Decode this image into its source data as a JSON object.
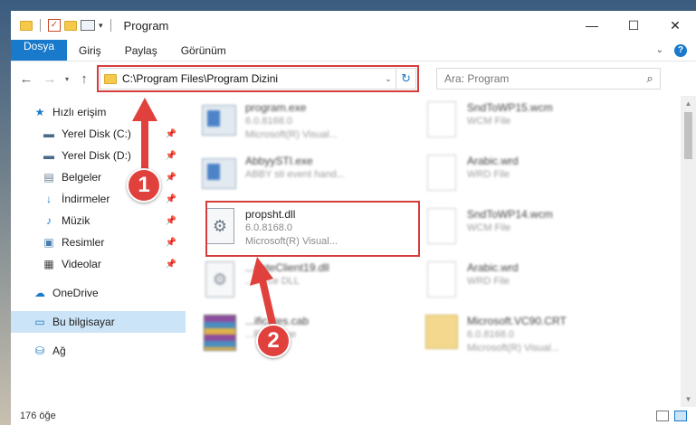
{
  "window": {
    "title": "Program",
    "controls": {
      "minimize": "—",
      "maximize": "☐",
      "close": "✕"
    }
  },
  "ribbon": {
    "tabs": [
      "Dosya",
      "Giriş",
      "Paylaş",
      "Görünüm"
    ],
    "help_label": "?"
  },
  "address": {
    "path": "C:\\Program Files\\Program Dizini"
  },
  "search": {
    "placeholder": "Ara: Program"
  },
  "sidebar": {
    "quick_access": "Hızlı erişim",
    "items": [
      {
        "label": "Yerel Disk (C:)",
        "icon": "drive-icon"
      },
      {
        "label": "Yerel Disk (D:)",
        "icon": "drive-icon"
      },
      {
        "label": "Belgeler",
        "icon": "documents-icon"
      },
      {
        "label": "İndirmeler",
        "icon": "download-icon"
      },
      {
        "label": "Müzik",
        "icon": "music-icon"
      },
      {
        "label": "Resimler",
        "icon": "pictures-icon"
      },
      {
        "label": "Videolar",
        "icon": "videos-icon"
      }
    ],
    "onedrive": "OneDrive",
    "this_pc": "Bu bilgisayar",
    "network": "Ağ"
  },
  "files": [
    {
      "name": "program.exe",
      "line2": "6.0.8168.0",
      "line3": "Microsoft(R) Visual...",
      "icon": "setup-exe-icon",
      "blur": true
    },
    {
      "name": "SndToWP15.wcm",
      "line2": "WCM File",
      "line3": "",
      "icon": "document-icon",
      "blur": true
    },
    {
      "name": "AbbyySTI.exe",
      "line2": "ABBY sti event hand...",
      "line3": "",
      "icon": "exe-icon",
      "blur": true
    },
    {
      "name": "Arabic.wrd",
      "line2": "WRD File",
      "line3": "",
      "icon": "document-icon",
      "blur": true
    },
    {
      "name": "propsht.dll",
      "line2": "6.0.8168.0",
      "line3": "Microsoft(R) Visual...",
      "icon": "dll-gear-icon",
      "blur": false
    },
    {
      "name": "SndToWP14.wcm",
      "line2": "WCM File",
      "line3": "",
      "icon": "document-icon",
      "blur": true
    },
    {
      "name": "...dateClient19.dll",
      "line2": "...ource DLL",
      "line3": "",
      "icon": "dll-gear-icon",
      "blur": true
    },
    {
      "name": "Arabic.wrd",
      "line2": "WRD File",
      "line3": "",
      "icon": "document-icon",
      "blur": true
    },
    {
      "name": "...ificates.cab",
      "line2": "...R Archive",
      "line3": "",
      "icon": "winrar-icon",
      "blur": true
    },
    {
      "name": "Microsoft.VC90.CRT",
      "line2": "6.0.8168.0",
      "line3": "Microsoft(R) Visual...",
      "icon": "folder-icon",
      "blur": true
    }
  ],
  "callouts": [
    "1",
    "2"
  ],
  "status": {
    "count": "176 öğe"
  },
  "colors": {
    "accent": "#1979ca",
    "highlight": "#d53d3d",
    "callout": "#e0413d",
    "selected": "#cce4f7"
  }
}
